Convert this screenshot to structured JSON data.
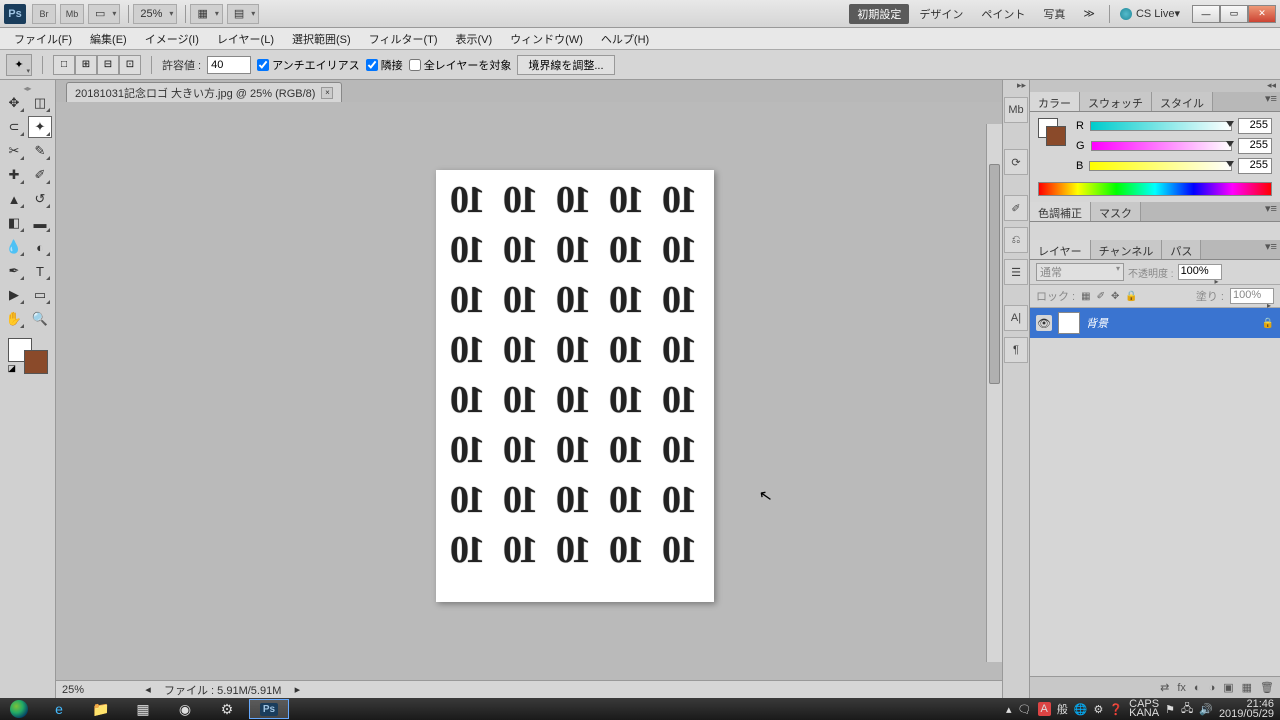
{
  "titlebar": {
    "app_buttons": [
      "Br",
      "Mb"
    ],
    "zoom_dd": "25%",
    "workspaces": [
      "初期設定",
      "デザイン",
      "ペイント",
      "写真"
    ],
    "active_ws": 0,
    "more": "≫",
    "cslive": "CS Live"
  },
  "menu": [
    "ファイル(F)",
    "編集(E)",
    "イメージ(I)",
    "レイヤー(L)",
    "選択範囲(S)",
    "フィルター(T)",
    "表示(V)",
    "ウィンドウ(W)",
    "ヘルプ(H)"
  ],
  "options": {
    "tolerance_label": "許容値 :",
    "tolerance_value": "40",
    "antialias": "アンチエイリアス",
    "contiguous": "隣接",
    "all_layers": "全レイヤーを対象",
    "refine_edge": "境界線を調整..."
  },
  "doc": {
    "tab": "20181031記念ロゴ 大きい方.jpg @ 25% (RGB/8)",
    "logo_text": "10",
    "status_zoom": "25%",
    "status_file": "ファイル : 5.91M/5.91M"
  },
  "panels": {
    "color": {
      "tab_color": "カラー",
      "tab_swatch": "スウォッチ",
      "tab_style": "スタイル",
      "r": "R",
      "g": "G",
      "b": "B",
      "r_val": "255",
      "g_val": "255",
      "b_val": "255"
    },
    "adjust": {
      "tab_adj": "色調補正",
      "tab_mask": "マスク"
    },
    "layers": {
      "tab_layer": "レイヤー",
      "tab_channel": "チャンネル",
      "tab_path": "パス",
      "blend": "通常",
      "opacity_label": "不透明度 :",
      "opacity": "100%",
      "lock_label": "ロック :",
      "fill_label": "塗り :",
      "fill": "100%",
      "layer_name": "背景"
    }
  },
  "taskbar": {
    "ime_a": "A",
    "ime_han": "般",
    "caps": "CAPS",
    "kana": "KANA",
    "time": "21:46",
    "date": "2019/05/29"
  }
}
